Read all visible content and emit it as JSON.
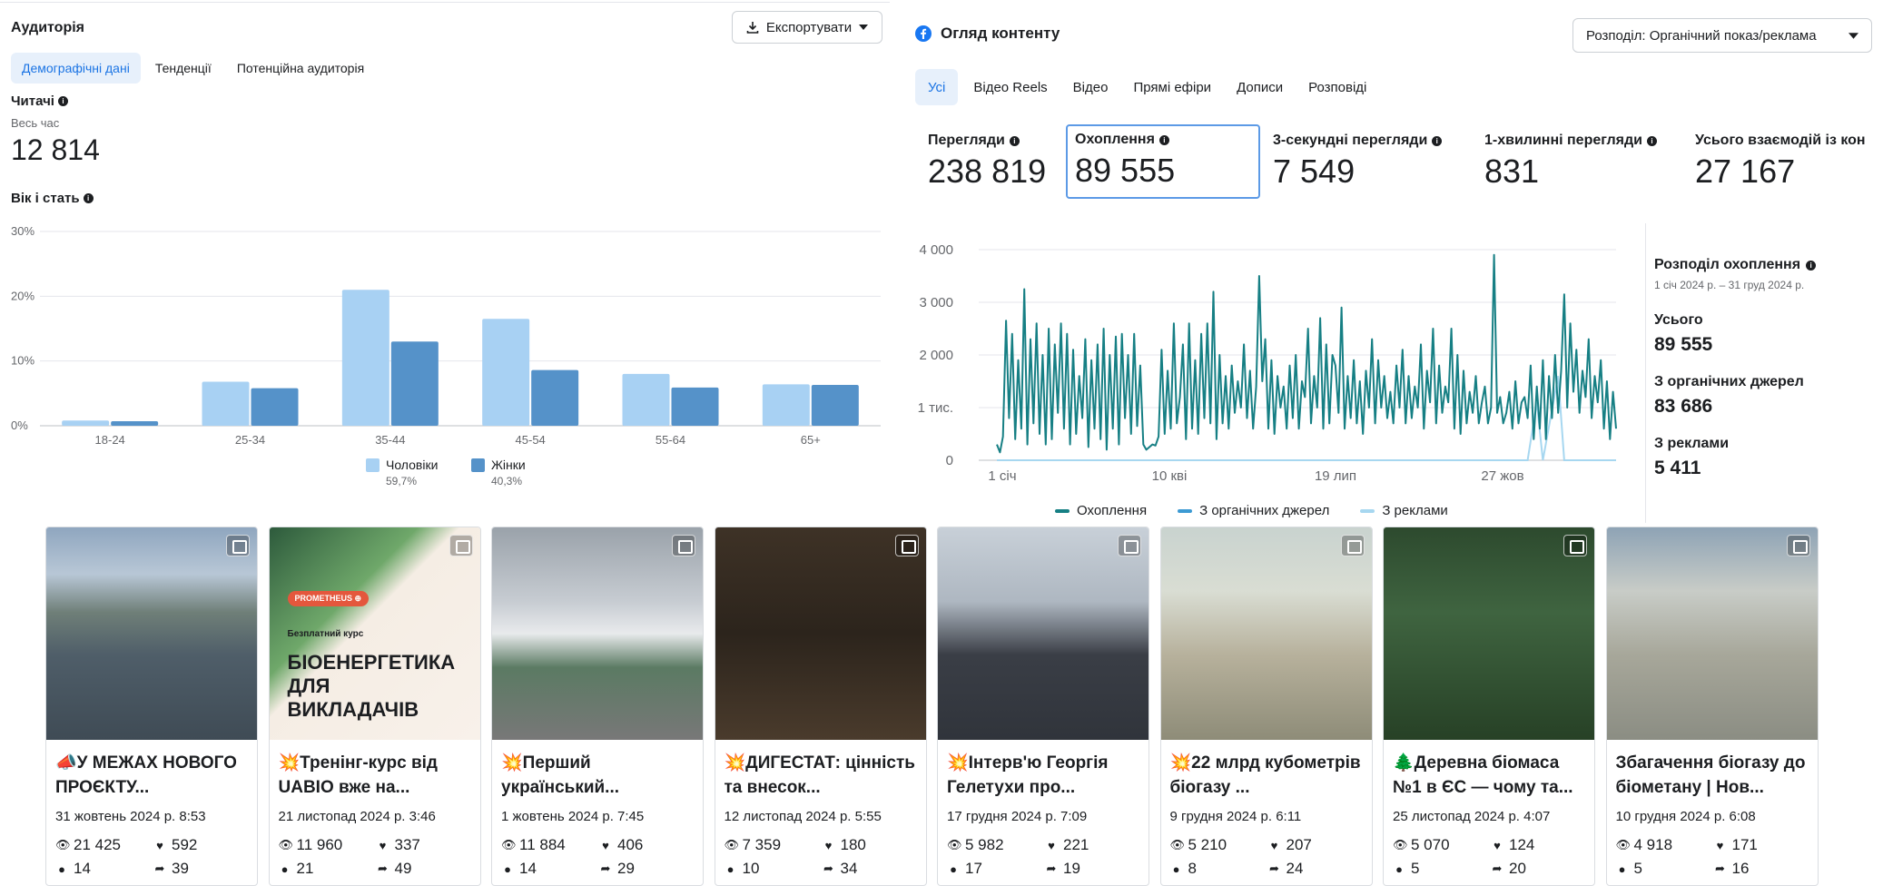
{
  "audience": {
    "title": "Аудиторія",
    "export_label": "Експортувати",
    "tabs": [
      "Демографічні дані",
      "Тенденції",
      "Потенційна аудиторія"
    ],
    "readers_label": "Читачі",
    "period": "Весь час",
    "readers_value": "12 814",
    "age_gender_label": "Вік і стать"
  },
  "age_chart": {
    "chart_data": {
      "type": "bar",
      "categories": [
        "18-24",
        "25-34",
        "35-44",
        "45-54",
        "55-64",
        "65+"
      ],
      "series": [
        {
          "name": "Чоловіки",
          "values": [
            0.8,
            6.8,
            21.0,
            16.5,
            8.0,
            6.4
          ],
          "color": "#a8d1f3",
          "share": "59,7%"
        },
        {
          "name": "Жінки",
          "values": [
            0.7,
            5.8,
            13.0,
            8.6,
            5.9,
            6.3
          ],
          "color": "#5592c9",
          "share": "40,3%"
        }
      ],
      "ylim": [
        0,
        30
      ],
      "yticks": [
        "0%",
        "10%",
        "20%",
        "30%"
      ],
      "grid": true,
      "legend": "bottom"
    }
  },
  "content": {
    "title": "Огляд контенту",
    "breakdown_label": "Розподіл: Органічний показ/реклама",
    "tabs": [
      "Усі",
      "Відео Reels",
      "Відео",
      "Прямі ефіри",
      "Дописи",
      "Розповіді"
    ],
    "metrics": [
      {
        "label": "Перегляди",
        "value": "238 819"
      },
      {
        "label": "Охоплення",
        "value": "89 555"
      },
      {
        "label": "3-секундні перегляди",
        "value": "7 549"
      },
      {
        "label": "1-хвилинні перегляди",
        "value": "831"
      },
      {
        "label": "Усього взаємодій із кон",
        "value": "27 167"
      }
    ],
    "legend": [
      "Охоплення",
      "З органічних джерел",
      "З реклами"
    ],
    "distribution": {
      "title": "Розподіл охоплення",
      "period": "1 січ 2024 р. – 31 груд 2024 р.",
      "total_label": "Усього",
      "total_value": "89 555",
      "organic_label": "З органічних джерел",
      "organic_value": "83 686",
      "ads_label": "З реклами",
      "ads_value": "5 411"
    }
  },
  "reach_chart": {
    "chart_data": {
      "type": "line",
      "x_ticks": [
        "1 січ",
        "10 кві",
        "19 лип",
        "27 жов"
      ],
      "y_ticks": [
        "0",
        "1 тис.",
        "2 000",
        "3 000",
        "4 000"
      ],
      "ylim": [
        0,
        4000
      ],
      "series": [
        {
          "name": "Охоплення",
          "color": "#167f84",
          "values": [
            300,
            150,
            450,
            2650,
            800,
            2400,
            400,
            1900,
            600,
            3250,
            300,
            2300,
            700,
            2600,
            500,
            2000,
            300,
            2500,
            400,
            2200,
            900,
            2600,
            600,
            2400,
            300,
            2100,
            500,
            1600,
            800,
            2300,
            250,
            1900,
            600,
            2200,
            400,
            2500,
            200,
            2000,
            600,
            2350,
            300,
            2400,
            800,
            2000,
            500,
            2400,
            650,
            1800,
            300,
            200,
            250,
            300,
            280,
            450,
            2100,
            500,
            1700,
            600,
            2600,
            700,
            1200,
            2200,
            400,
            2600,
            600,
            1900,
            500,
            2400,
            800,
            2600,
            700,
            3200,
            400,
            2000,
            700,
            1600,
            600,
            1800,
            900,
            1500,
            1000,
            2200,
            800,
            1700,
            600,
            1400,
            3500,
            1500,
            2300,
            600,
            1900,
            500,
            1600,
            1000,
            1400,
            600,
            1800,
            800,
            2000,
            600,
            1500,
            1200,
            2500,
            700,
            1600,
            1000,
            2700,
            600,
            2200,
            700,
            2000,
            1800,
            900,
            2900,
            600,
            1600,
            800,
            1900,
            700,
            1500,
            500,
            1700,
            1000,
            2300,
            700,
            1900,
            1000,
            1600,
            800,
            1300,
            700,
            1800,
            1000,
            2100,
            700,
            1600,
            800,
            1400,
            1000,
            2200,
            600,
            1700,
            1100,
            2500,
            700,
            1800,
            900,
            1400,
            1100,
            2500,
            600,
            2000,
            500,
            1700,
            700,
            1300,
            900,
            1600,
            700,
            1100,
            1400,
            700,
            1000,
            3900,
            900,
            1200,
            700,
            900,
            1300,
            600,
            1500,
            700,
            1100,
            1200,
            800,
            1800,
            400,
            1400,
            600,
            1900,
            400,
            1600,
            800,
            2000,
            900,
            1700,
            3150,
            1000,
            2600,
            1300,
            2100,
            900,
            1700,
            1200,
            2300,
            800,
            1600,
            1100,
            1900,
            600,
            1500,
            400,
            1300,
            600
          ]
        },
        {
          "name": "З органічних джерел",
          "color": "#3c9ad3"
        },
        {
          "name": "З реклами",
          "color": "#a7d7f0"
        }
      ]
    }
  },
  "posts": [
    {
      "title": "📣У МЕЖАХ НОВОГО ПРОЄКТУ...",
      "date": "31 жовтень 2024 р. 8:53",
      "views": "21 425",
      "likes": "592",
      "comments": "14",
      "shares": "39"
    },
    {
      "title": "💥Тренінг-курс від UABIO вже на...",
      "date": "21 листопад 2024 р. 3:46",
      "views": "11 960",
      "likes": "337",
      "comments": "21",
      "shares": "49",
      "image_badge": "PROMETHEUS ⊕",
      "image_sub": "Безплатний курс",
      "image_heading": "БІОЕНЕРГЕТИКА ДЛЯ ВИКЛАДАЧІВ"
    },
    {
      "title": "💥Перший український...",
      "date": "1 жовтень 2024 р. 7:45",
      "views": "11 884",
      "likes": "406",
      "comments": "14",
      "shares": "29"
    },
    {
      "title": "💥ДИГЕСТАТ: цінність та внесок...",
      "date": "12 листопад 2024 р. 5:55",
      "views": "7 359",
      "likes": "180",
      "comments": "10",
      "shares": "34"
    },
    {
      "title": "💥Інтерв'ю Георгія Гелетухи про...",
      "date": "17 грудня 2024 р. 7:09",
      "views": "5 982",
      "likes": "221",
      "comments": "17",
      "shares": "19"
    },
    {
      "title": "💥22 млрд кубометрів біогазу ...",
      "date": "9 грудня 2024 р. 6:11",
      "views": "5 210",
      "likes": "207",
      "comments": "8",
      "shares": "24"
    },
    {
      "title": "🌲Деревна біомаса №1 в ЄС — чому та...",
      "date": "25 листопад 2024 р. 4:07",
      "views": "5 070",
      "likes": "124",
      "comments": "5",
      "shares": "20"
    },
    {
      "title": "Збагачення біогазу до біометану | Нов...",
      "date": "10 грудня 2024 р. 6:08",
      "views": "4 918",
      "likes": "171",
      "comments": "5",
      "shares": "16"
    }
  ],
  "icons": {
    "views": "eye-icon",
    "likes": "heart-icon",
    "comments": "comment-icon",
    "shares": "share-icon"
  },
  "colors": {
    "accent": "#1b74e4",
    "line": "#167f84",
    "male": "#a8d1f3",
    "female": "#5592c9"
  }
}
